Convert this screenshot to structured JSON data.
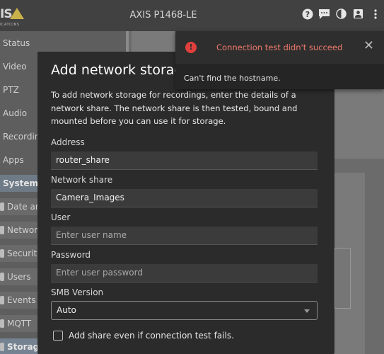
{
  "header": {
    "logo_text": "IS",
    "logo_sub": "ICATIONS",
    "device_name": "AXIS P1468-LE"
  },
  "sidebar": {
    "items": [
      {
        "label": "Status"
      },
      {
        "label": "Video"
      },
      {
        "label": "PTZ"
      },
      {
        "label": "Audio"
      },
      {
        "label": "Recording"
      },
      {
        "label": "Apps"
      }
    ],
    "section": {
      "label": "System"
    },
    "sub_items": [
      {
        "label": "Date and"
      },
      {
        "label": "Network"
      },
      {
        "label": "Security"
      },
      {
        "label": "Users"
      },
      {
        "label": "Events"
      },
      {
        "label": "MQTT"
      },
      {
        "label": "Storage"
      }
    ]
  },
  "toast": {
    "title": "Connection test didn't succeed",
    "message": "Can't find the hostname.",
    "close": "✕",
    "error_icon": "!"
  },
  "modal": {
    "title": "Add network storage",
    "description": "To add network storage for recordings, enter the details of a network share. The network share is then tested, bound and mounted before you can use it for storage.",
    "address": {
      "label": "Address",
      "value": "router_share"
    },
    "share": {
      "label": "Network share",
      "value": "Camera_Images"
    },
    "user": {
      "label": "User",
      "placeholder": "Enter user name"
    },
    "password": {
      "label": "Password",
      "placeholder": "Enter user password"
    },
    "smb": {
      "label": "SMB Version",
      "value": "Auto"
    },
    "checkbox_label": "Add share even if connection test fails."
  }
}
